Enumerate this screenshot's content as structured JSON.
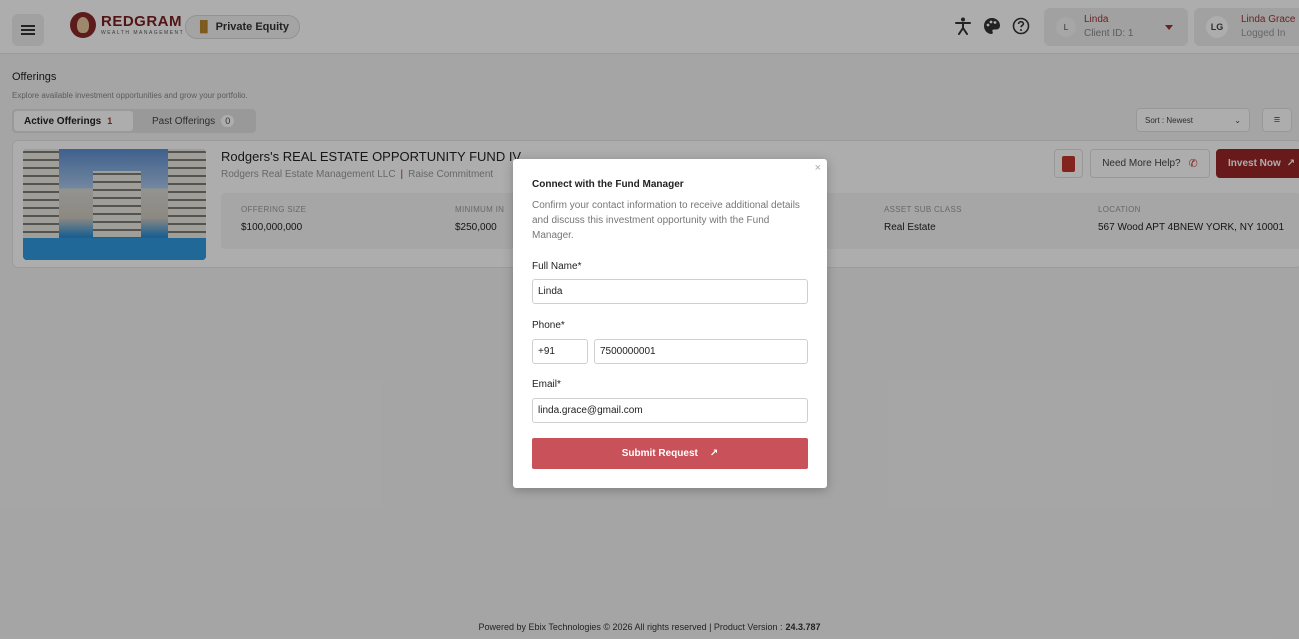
{
  "header": {
    "brand_name": "REDGRAM",
    "brand_sub": "WEALTH MANAGEMENT",
    "product_chip": "Private Equity",
    "client": {
      "avatar": "L",
      "name": "Linda",
      "id_text": "Client ID: 1"
    },
    "user": {
      "avatar": "LG",
      "name": "Linda Grace",
      "status": "Logged In"
    },
    "icons": [
      "accessibility-icon",
      "palette-icon",
      "help-circle-icon"
    ]
  },
  "page": {
    "title": "Offerings",
    "subtitle": "Explore available investment opportunities and grow your portfolio.",
    "tabs": [
      {
        "label": "Active Offerings",
        "count": "1"
      },
      {
        "label": "Past Offerings",
        "count": "0"
      }
    ],
    "sort_label": "Sort : Newest"
  },
  "offering": {
    "title": "Rodgers's REAL ESTATE OPPORTUNITY FUND IV",
    "company": "Rodgers Real Estate Management LLC",
    "meta_tail": "Raise Commitment",
    "stats": [
      {
        "label": "OFFERING SIZE",
        "value": "$100,000,000"
      },
      {
        "label": "MINIMUM IN",
        "value": "$250,000"
      },
      {
        "label": "ASSET SUB CLASS",
        "value": "Real Estate"
      },
      {
        "label": "LOCATION",
        "value": "567 Wood APT 4BNEW YORK, NY 10001"
      }
    ],
    "help_label": "Need More Help?",
    "invest_label": "Invest Now"
  },
  "modal": {
    "close": "×",
    "title": "Connect with the Fund Manager",
    "description": "Confirm your contact information to receive additional details and discuss this investment opportunity with the Fund Manager.",
    "full_name_label": "Full Name*",
    "full_name_value": "Linda",
    "phone_label": "Phone*",
    "phone_code": "+91",
    "phone_value": "7500000001",
    "email_label": "Email*",
    "email_value": "linda.grace@gmail.com",
    "submit_label": "Submit Request"
  },
  "footer": {
    "text": "Powered by Ebix Technologies © 2026 All rights reserved | Product Version :",
    "version": "24.3.787"
  },
  "colors": {
    "brand": "#9a2525",
    "submit": "#c9515a",
    "overlay": "rgba(0,0,0,0.32)"
  }
}
